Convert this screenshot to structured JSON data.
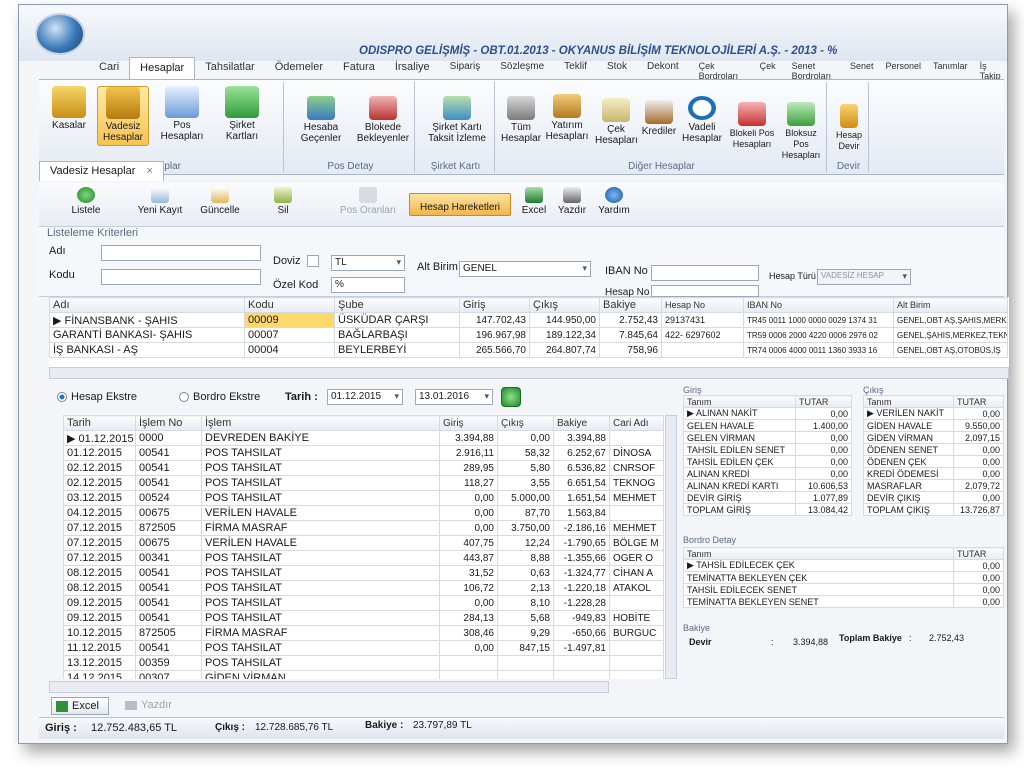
{
  "app": {
    "title": "ODISPRO GELİŞMİŞ - OBT.01.2013 - OKYANUS BİLİŞİM TEKNOLOJİLERİ A.Ş. - 2013 - %",
    "window_controls": "- □ ×"
  },
  "main_tabs": [
    "Cari",
    "Hesaplar",
    "Tahsilatlar",
    "Ödemeler",
    "Fatura",
    "İrsaliye",
    "Sipariş",
    "Sözleşme",
    "Teklif",
    "Stok",
    "Dekont",
    "Çek Bordroları",
    "Çek",
    "Senet Bordroları",
    "Senet",
    "Personel",
    "Tanımlar",
    "İş Takip"
  ],
  "ribbon": {
    "groups": [
      "Hesaplar",
      "Pos Detay",
      "Şirket Kartı",
      "Diğer Hesaplar",
      "Devir"
    ],
    "buttons": {
      "kasalar": "Kasalar",
      "vadesiz": "Vadesiz Hesaplar",
      "pos": "Pos Hesapları",
      "sirket_kartlari": "Şirket Kartları",
      "hesaba_gecenler": "Hesaba Geçenler",
      "blokede": "Blokede Bekleyenler",
      "sirket_karti_taksit": "Şirket Kartı Taksit İzleme",
      "tum": "Tüm Hesaplar",
      "yatirim": "Yatırım Hesapları",
      "cek": "Çek Hesapları",
      "krediler": "Krediler",
      "vadeli": "Vadeli Hesaplar",
      "blokeli_pos": "Blokeli Pos Hesapları",
      "bloksuz_pos": "Bloksuz Pos Hesapları",
      "hesap_devir": "Hesap Devir"
    }
  },
  "doc_tab": {
    "label": "Vadesiz Hesaplar",
    "close": "×"
  },
  "toolbar": {
    "listele": "Listele",
    "yeni": "Yeni Kayıt",
    "guncelle": "Güncelle",
    "sil": "Sil",
    "pos_oranlari": "Pos Oranları",
    "hesap_hareketleri": "Hesap Hareketleri",
    "excel": "Excel",
    "yazdir": "Yazdır",
    "yardim": "Yardım"
  },
  "criteria": {
    "title": "Listeleme Kriterleri",
    "adi_label": "Adı",
    "adi_value": "",
    "kodu_label": "Kodu",
    "kodu_value": "",
    "doviz_label": "Doviz",
    "doviz_value": "TL",
    "ozel_kod_label": "Özel Kod",
    "ozel_kod_value": "%",
    "alt_birim_label": "Alt Birim",
    "alt_birim_value": "GENEL",
    "iban_label": "IBAN No",
    "iban_value": "",
    "hesap_no_label": "Hesap No",
    "hesap_no_value": "",
    "hesap_turu_label": "Hesap Türü",
    "hesap_turu_value": "VADESİZ HESAP"
  },
  "bank_grid": {
    "columns": [
      "Adı",
      "Kodu",
      "Şube",
      "Giriş",
      "Çıkış",
      "Bakiye",
      "Hesap No",
      "IBAN No",
      "Alt Birim"
    ],
    "rows": [
      [
        "FİNANSBANK - ŞAHIS",
        "00009",
        "ÜSKÜDAR ÇARŞI",
        "147.702,43",
        "144.950,00",
        "2.752,43",
        "29137431",
        "TR45 0011 1000 0000 0029 1374 31",
        "GENEL,OBT AŞ,ŞAHIS,MERKEZ"
      ],
      [
        "GARANTİ BANKASI- ŞAHIS",
        "00007",
        "BAĞLARBAŞI",
        "196.967,98",
        "189.122,34",
        "7.845,64",
        "422- 6297602",
        "TR59 0006 2000 4220 0006 2976 02",
        "GENEL,ŞAHIS,MERKEZ,TEKNO"
      ],
      [
        "İŞ BANKASI - AŞ",
        "00004",
        "BEYLERBEYİ",
        "265.566,70",
        "264.807,74",
        "758,96",
        "",
        "TR74 0006 4000 0011 1360 3933 16",
        "GENEL,OBT AŞ,OTOBÜS,İŞ"
      ]
    ]
  },
  "filter": {
    "hesap_ekstre": "Hesap Ekstre",
    "bordro_ekstre": "Bordro Ekstre",
    "tarih_label": "Tarih :",
    "date_from": "01.12.2015",
    "date_to": "13.01.2016"
  },
  "statement": {
    "columns": [
      "Tarih",
      "İşlem No",
      "İşlem",
      "Giriş",
      "Çıkış",
      "Bakiye",
      "Cari Adı"
    ],
    "rows": [
      [
        "01.12.2015",
        "0000",
        "DEVREDEN BAKİYE",
        "3.394,88",
        "0,00",
        "3.394,88",
        ""
      ],
      [
        "01.12.2015",
        "00541",
        "POS TAHSILAT",
        "2.916,11",
        "58,32",
        "6.252,67",
        "DİNOSA"
      ],
      [
        "02.12.2015",
        "00541",
        "POS TAHSILAT",
        "289,95",
        "5,80",
        "6.536,82",
        "CNRSOF"
      ],
      [
        "02.12.2015",
        "00541",
        "POS TAHSILAT",
        "118,27",
        "3,55",
        "6.651,54",
        "TEKNOG"
      ],
      [
        "03.12.2015",
        "00524",
        "POS TAHSILAT",
        "0,00",
        "5.000,00",
        "1.651,54",
        "MEHMET"
      ],
      [
        "04.12.2015",
        "00675",
        "VERİLEN HAVALE",
        "0,00",
        "87,70",
        "1.563,84",
        ""
      ],
      [
        "07.12.2015",
        "872505",
        "FİRMA MASRAF",
        "0,00",
        "3.750,00",
        "-2.186,16",
        "MEHMET"
      ],
      [
        "07.12.2015",
        "00675",
        "VERİLEN HAVALE",
        "407,75",
        "12,24",
        "-1.790,65",
        "BÖLGE M"
      ],
      [
        "07.12.2015",
        "00341",
        "POS TAHSILAT",
        "443,87",
        "8,88",
        "-1.355,66",
        "OGER O"
      ],
      [
        "08.12.2015",
        "00541",
        "POS TAHSILAT",
        "31,52",
        "0,63",
        "-1.324,77",
        "CİHAN A"
      ],
      [
        "08.12.2015",
        "00541",
        "POS TAHSILAT",
        "106,72",
        "2,13",
        "-1.220,18",
        "ATAKOL"
      ],
      [
        "09.12.2015",
        "00541",
        "POS TAHSILAT",
        "0,00",
        "8,10",
        "-1.228,28",
        ""
      ],
      [
        "09.12.2015",
        "00541",
        "POS TAHSILAT",
        "284,13",
        "5,68",
        "-949,83",
        "HOBİTE"
      ],
      [
        "10.12.2015",
        "872505",
        "FİRMA MASRAF",
        "308,46",
        "9,29",
        "-650,66",
        "BURGUC"
      ],
      [
        "11.12.2015",
        "00541",
        "POS TAHSILAT",
        "0,00",
        "847,15",
        "-1.497,81",
        ""
      ],
      [
        "13.12.2015",
        "00359",
        "POS TAHSILAT",
        "",
        "",
        "",
        ""
      ],
      [
        "14.12.2015",
        "00307",
        "GİDEN VİRMAN",
        "",
        "",
        "",
        ""
      ]
    ]
  },
  "giris": {
    "title": "Giriş",
    "columns": [
      "Tanım",
      "TUTAR"
    ],
    "rows": [
      [
        "ALINAN NAKİT",
        "0,00"
      ],
      [
        "GELEN HAVALE",
        "1.400,00"
      ],
      [
        "GELEN VİRMAN",
        "0,00"
      ],
      [
        "TAHSİL EDİLEN SENET",
        "0,00"
      ],
      [
        "TAHSİL EDİLEN ÇEK",
        "0,00"
      ],
      [
        "ALINAN KREDİ",
        "0,00"
      ],
      [
        "ALINAN KREDİ KARTI",
        "10.606,53"
      ],
      [
        "DEVİR GİRİŞ",
        "1.077,89"
      ],
      [
        "TOPLAM GİRİŞ",
        "13.084,42"
      ]
    ]
  },
  "cikis": {
    "title": "Çıkış",
    "columns": [
      "Tanım",
      "TUTAR"
    ],
    "rows": [
      [
        "VERİLEN NAKİT",
        "0,00"
      ],
      [
        "GİDEN HAVALE",
        "9.550,00"
      ],
      [
        "GİDEN VİRMAN",
        "2.097,15"
      ],
      [
        "ÖDENEN SENET",
        "0,00"
      ],
      [
        "ÖDENEN ÇEK",
        "0,00"
      ],
      [
        "KREDİ ÖDEMESİ",
        "0,00"
      ],
      [
        "MASRAFLAR",
        "2.079,72"
      ],
      [
        "DEVİR ÇIKIŞ",
        "0,00"
      ],
      [
        "TOPLAM ÇIKIŞ",
        "13.726,87"
      ]
    ]
  },
  "bordro": {
    "title": "Bordro Detay",
    "columns": [
      "Tanım",
      "TUTAR"
    ],
    "rows": [
      [
        "TAHSİL EDİLECEK ÇEK",
        "0,00"
      ],
      [
        "TEMİNATTA BEKLEYEN ÇEK",
        "0,00"
      ],
      [
        "TAHSİL EDİLECEK SENET",
        "0,00"
      ],
      [
        "TEMİNATTA BEKLEYEN SENET",
        "0,00"
      ]
    ]
  },
  "bakiye_box": {
    "title": "Bakiye",
    "devir_label": "Devir",
    "devir_sep": ":",
    "devir_value": "3.394,88",
    "toplam_label": "Toplam Bakiye",
    "toplam_sep": ":",
    "toplam_value": "2.752,43"
  },
  "bottom": {
    "excel": "Excel",
    "yazdir": "Yazdır"
  },
  "status": {
    "giris_label": "Giriş :",
    "giris_value": "12.752.483,65 TL",
    "cikis_label": "Çıkış :",
    "cikis_value": "12.728.685,76 TL",
    "bakiye_label": "Bakiye :",
    "bakiye_value": "23.797,89 TL"
  }
}
